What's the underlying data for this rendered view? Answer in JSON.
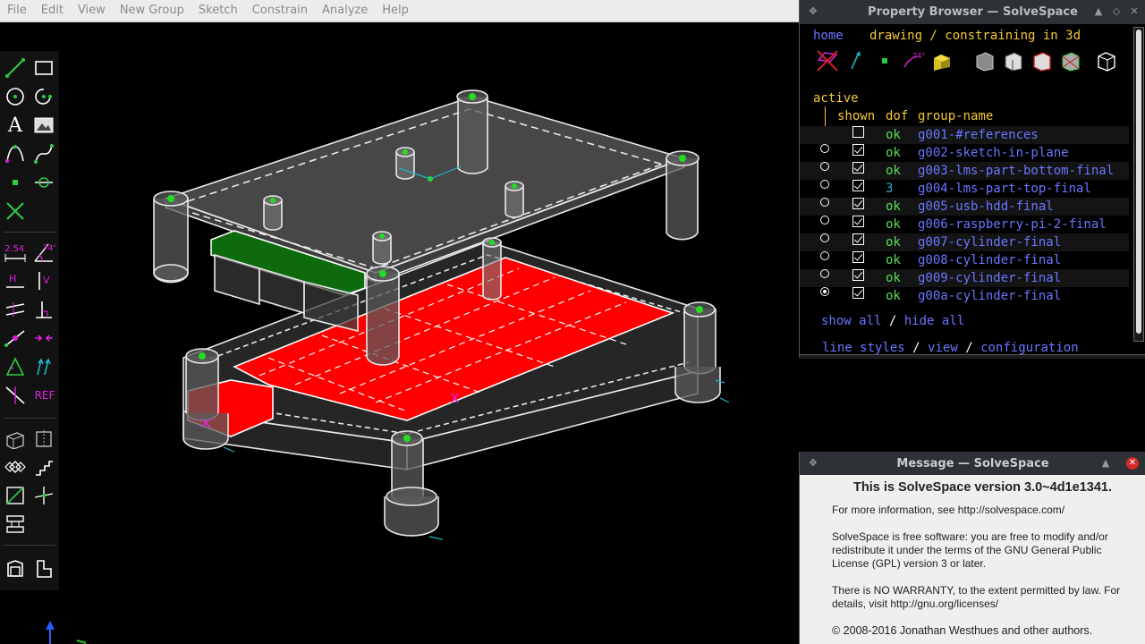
{
  "menu": [
    "File",
    "Edit",
    "View",
    "New Group",
    "Sketch",
    "Constrain",
    "Analyze",
    "Help"
  ],
  "property_browser": {
    "title": "Property Browser — SolveSpace",
    "nav_home": "home",
    "nav_context": "drawing / constraining in 3d",
    "active_label": "active",
    "header": {
      "shown": "shown",
      "dof": "dof",
      "group_name": "group-name"
    },
    "groups": [
      {
        "dof": "ok",
        "name": "g001-#references",
        "shown": false,
        "active": false,
        "radio": false
      },
      {
        "dof": "ok",
        "name": "g002-sketch-in-plane",
        "shown": true,
        "active": false,
        "radio": true
      },
      {
        "dof": "ok",
        "name": "g003-lms-part-bottom-final",
        "shown": true,
        "active": false,
        "radio": true
      },
      {
        "dof": "3",
        "name": "g004-lms-part-top-final",
        "shown": true,
        "active": false,
        "radio": true
      },
      {
        "dof": "ok",
        "name": "g005-usb-hdd-final",
        "shown": true,
        "active": false,
        "radio": true
      },
      {
        "dof": "ok",
        "name": "g006-raspberry-pi-2-final",
        "shown": true,
        "active": false,
        "radio": true
      },
      {
        "dof": "ok",
        "name": "g007-cylinder-final",
        "shown": true,
        "active": false,
        "radio": true
      },
      {
        "dof": "ok",
        "name": "g008-cylinder-final",
        "shown": true,
        "active": false,
        "radio": true
      },
      {
        "dof": "ok",
        "name": "g009-cylinder-final",
        "shown": true,
        "active": false,
        "radio": true
      },
      {
        "dof": "ok",
        "name": "g00a-cylinder-final",
        "shown": true,
        "active": true,
        "radio": true
      }
    ],
    "show_all": "show all",
    "slash": "/",
    "hide_all": "hide all",
    "line_styles": "line styles",
    "view": "view",
    "configuration": "configuration",
    "angle_badge": "74°"
  },
  "toolbar": {
    "dimension_label": "2.54",
    "angle_label": "74°",
    "horizontal_label": "H",
    "vertical_label": "V",
    "ref_label": "REF",
    "text_label": "A"
  },
  "message": {
    "title": "Message — SolveSpace",
    "heading": "This is SolveSpace version 3.0~4d1e1341.",
    "line1": "For more information, see http://solvespace.com/",
    "para2": "SolveSpace is free software: you are free to modify and/or redistribute it under the terms of the GNU General Public License (GPL) version 3 or later.",
    "para3": "There is NO WARRANTY, to the extent permitted by law. For details, visit http://gnu.org/licenses/",
    "copyright": "© 2008-2016 Jonathan Westhues and other authors."
  },
  "colors": {
    "accent_link": "#6b76ff",
    "yellow": "#f5c838",
    "ok_green": "#55e055",
    "face_red": "#ff0000",
    "face_green": "#0d6b0d",
    "tool_green": "#2ecc40",
    "tool_magenta": "#e020e0"
  }
}
